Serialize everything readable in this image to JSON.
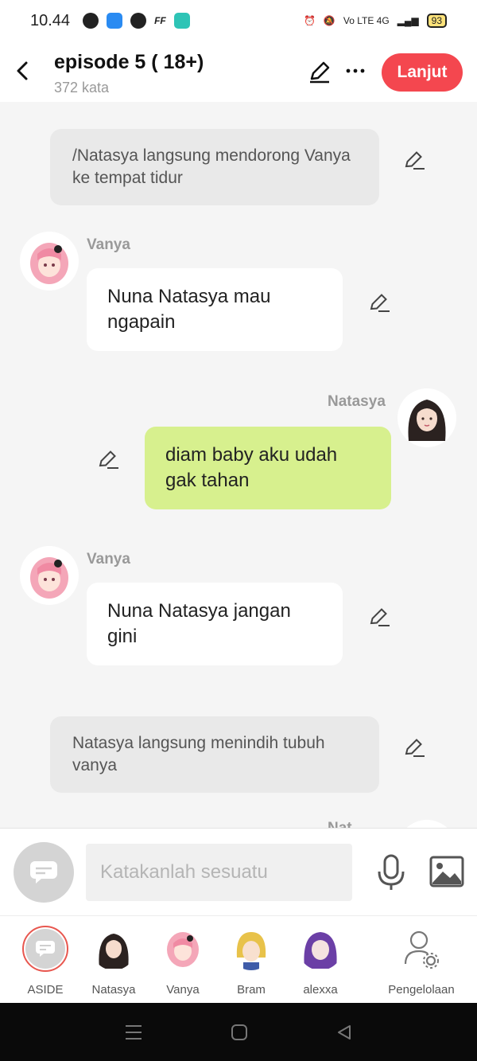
{
  "status_bar": {
    "time": "10.44",
    "right_text": "Vo LTE 4G",
    "battery": "93"
  },
  "header": {
    "title": "episode 5 ( 18+)",
    "subtitle": "372 kata",
    "next_label": "Lanjut"
  },
  "messages": [
    {
      "type": "narration",
      "text": "/Natasya langsung mendorong Vanya ke tempat tidur"
    },
    {
      "type": "incoming",
      "sender": "Vanya",
      "text": "Nuna Natasya mau ngapain"
    },
    {
      "type": "outgoing",
      "sender": "Natasya",
      "text": "diam baby aku udah gak tahan"
    },
    {
      "type": "incoming",
      "sender": "Vanya",
      "text": "Nuna Natasya jangan gini"
    },
    {
      "type": "narration",
      "text": "Natasya langsung menindih tubuh vanya"
    },
    {
      "type": "outgoing_partial",
      "sender": "Nat"
    }
  ],
  "composer": {
    "placeholder": "Katakanlah sesuatu"
  },
  "characters": [
    {
      "label": "ASIDE"
    },
    {
      "label": "Natasya"
    },
    {
      "label": "Vanya"
    },
    {
      "label": "Bram"
    },
    {
      "label": "alexxa"
    }
  ],
  "manage_label": "Pengelolaan",
  "colors": {
    "accent": "#f4474f",
    "outgoing_bubble": "#d7f08e",
    "incoming_bubble": "#ffffff",
    "narration_bg": "#e9e9e9"
  }
}
